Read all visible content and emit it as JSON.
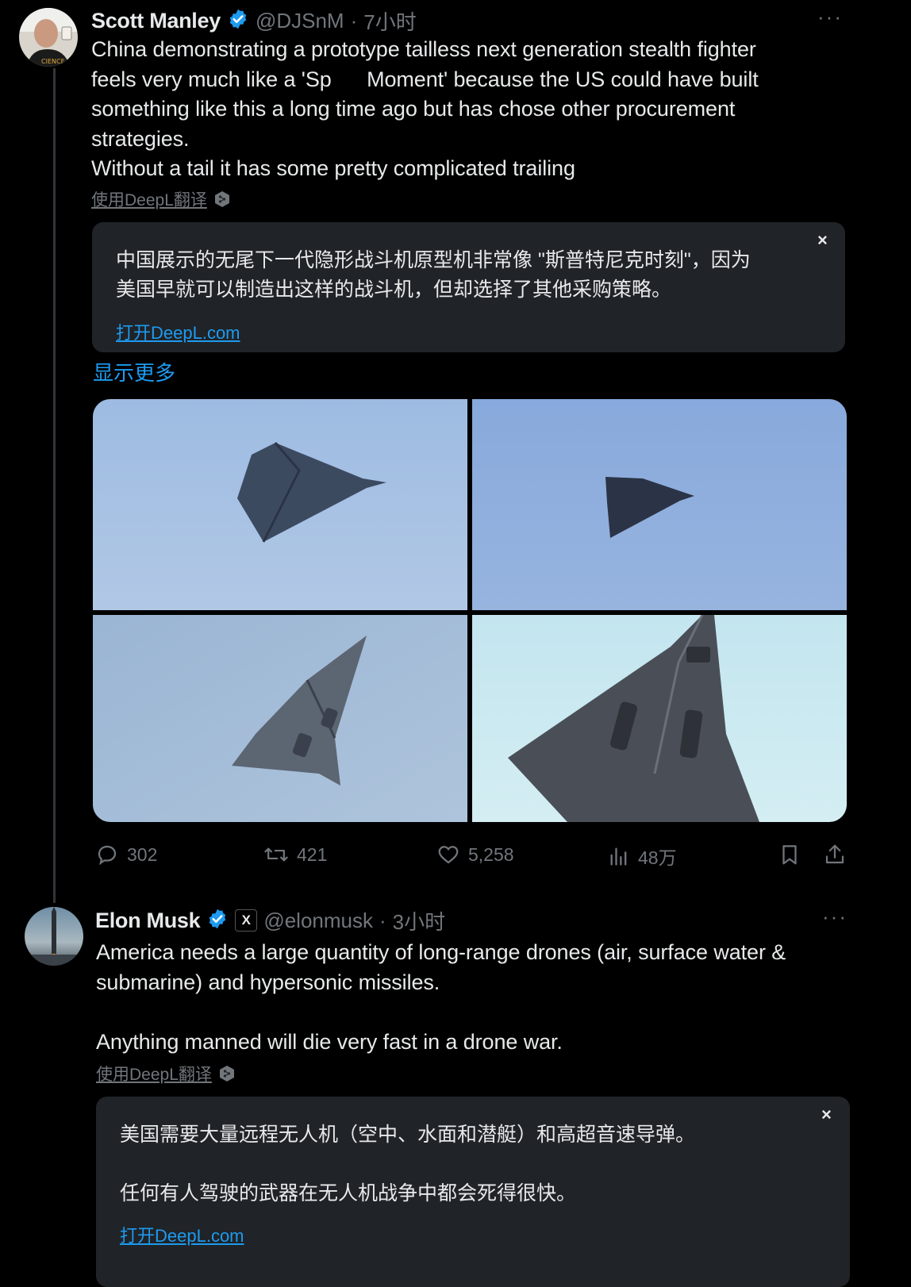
{
  "tweet1": {
    "author": {
      "name": "Scott Manley",
      "handle": "@DJSnM",
      "dot": "·",
      "time": "7小时",
      "avatar_icon": "person-avatar-icon",
      "verified_color": "#1d9bf0"
    },
    "text_lines": [
      "China demonstrating a prototype tailless next generation stealth fighter",
      "feels very much like a 'Sp      Moment' because the US could have built",
      "something like this a long time ago but has chose other procurement",
      "strategies.",
      "Without a tail it has some pretty complicated trailing"
    ],
    "translate_label": "使用DeepL翻译",
    "translation": {
      "lines": [
        "中国展示的无尾下一代隐形战斗机原型机非常像 \"斯普特尼克时刻\"，因为",
        "美国早就可以制造出这样的战斗机，但却选择了其他采购策略。"
      ],
      "link": "打开DeepL.com",
      "close": "×"
    },
    "show_more": "显示更多",
    "images": [
      {
        "description_icon": "tailless-fighter-photo",
        "sky": "#a6c1e3"
      },
      {
        "description_icon": "tailless-fighter-photo",
        "sky": "#8fb0df"
      },
      {
        "description_icon": "tailless-fighter-photo",
        "sky": "#a3bcd7"
      },
      {
        "description_icon": "tailless-fighter-photo",
        "sky": "#cbe9f1"
      }
    ],
    "actions": {
      "reply": "302",
      "retweet": "421",
      "like": "5,258",
      "views": "48万"
    }
  },
  "tweet2": {
    "author": {
      "name": "Elon Musk",
      "handle": "@elonmusk",
      "dot": "·",
      "time": "3小时",
      "affiliate_badge": "X",
      "avatar_icon": "rocket-avatar-icon",
      "verified_color": "#1d9bf0"
    },
    "text_lines": [
      "America needs a large quantity of long-range drones (air, surface water &",
      "submarine) and hypersonic missiles.",
      "",
      "Anything manned will die very fast in a drone war."
    ],
    "translate_label": "使用DeepL翻译",
    "translation": {
      "lines": [
        "美国需要大量远程无人机（空中、水面和潜艇）和高超音速导弹。",
        "",
        "任何有人驾驶的武器在无人机战争中都会死得很快。"
      ],
      "link": "打开DeepL.com",
      "close": "×"
    }
  },
  "more_glyph": "···"
}
